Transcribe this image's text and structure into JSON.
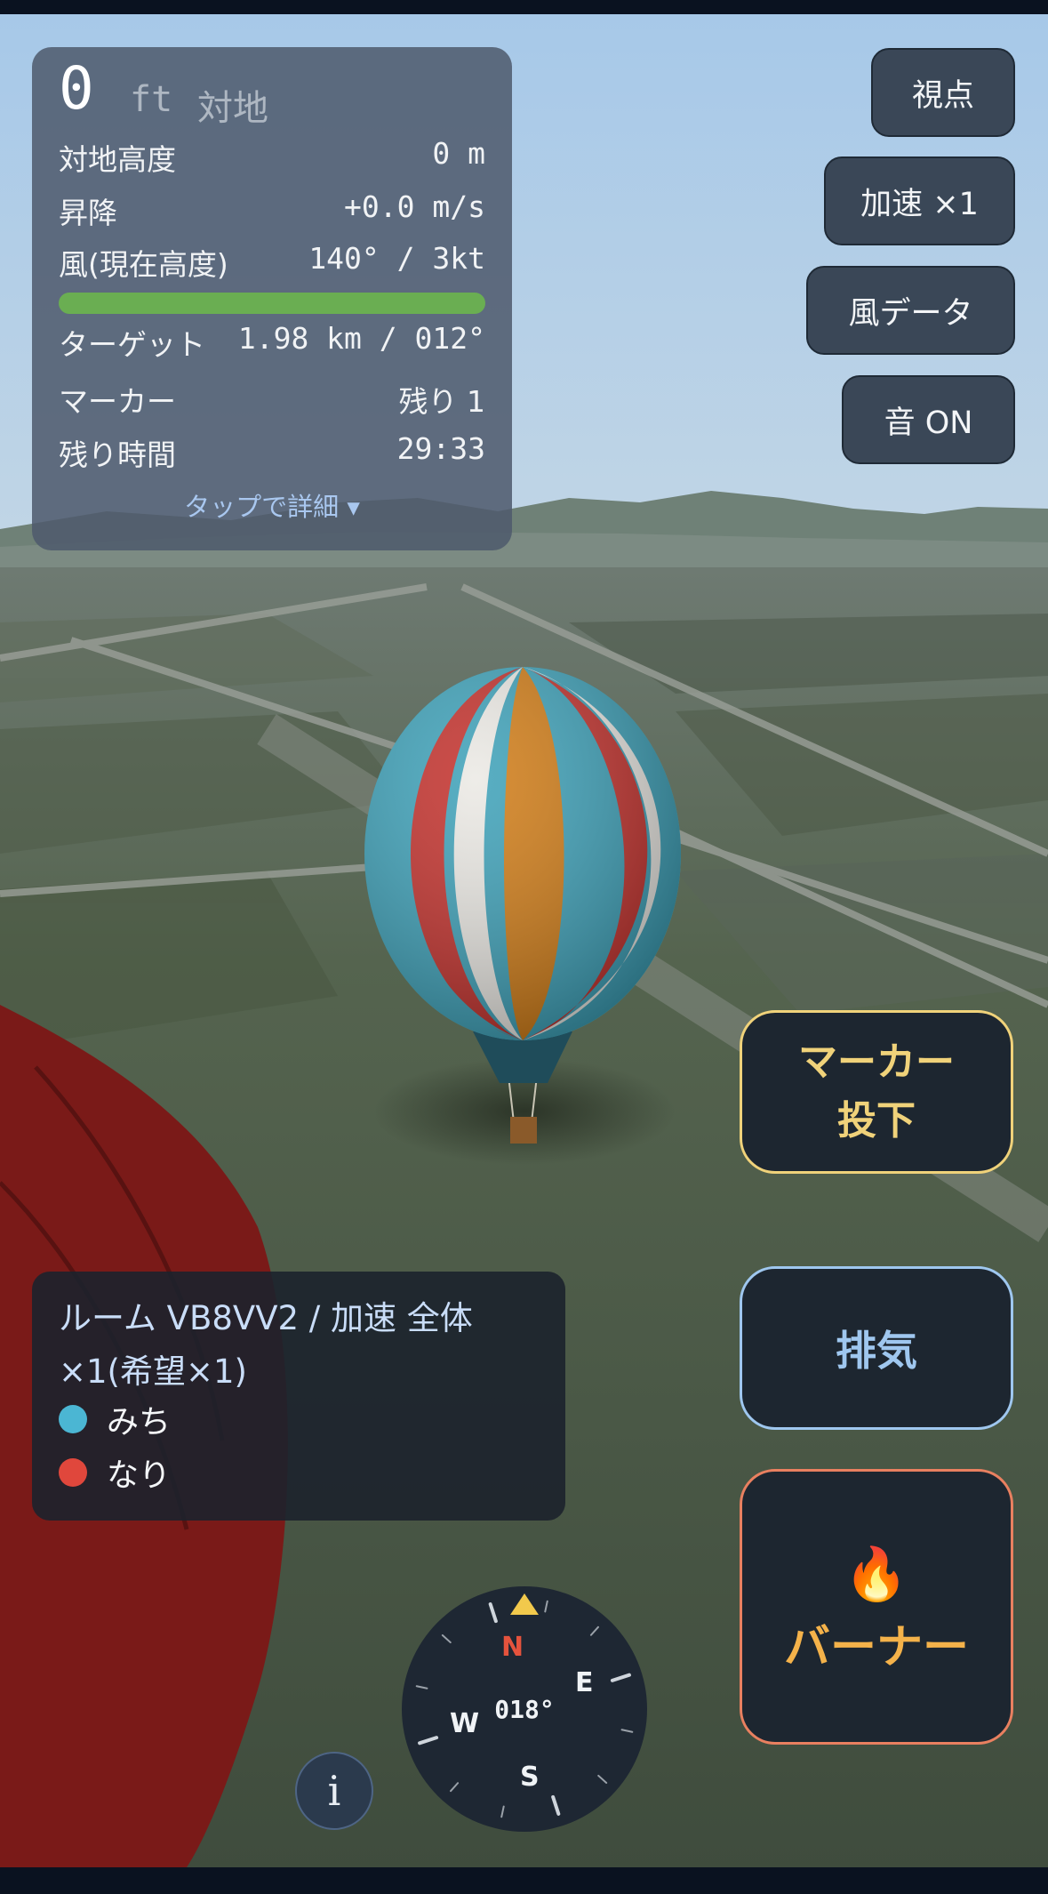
{
  "hud": {
    "altitude_value": "0",
    "altitude_unit": "ft",
    "altitude_ref": "対地",
    "rows": [
      {
        "label": "対地高度",
        "value": "0 m"
      },
      {
        "label": "昇降",
        "value": "+0.0 m/s"
      },
      {
        "label": "風(現在高度)",
        "value": "140° / 3kt"
      },
      {
        "label": "ターゲット",
        "value": "1.98 km / 012°"
      },
      {
        "label": "マーカー",
        "value": "残り 1"
      },
      {
        "label": "残り時間",
        "value": "29:33"
      }
    ],
    "wind_bar_fill": 1.0,
    "wind_bar_color": "#6aae52",
    "detail_link": "タップで詳細 ▾"
  },
  "top_buttons": {
    "view": "視点",
    "speed": "加速 ×1",
    "wind_data": "風データ",
    "sound": "音 ON"
  },
  "action_buttons": {
    "marker_line1": "マーカー",
    "marker_line2": "投下",
    "marker_color": "#f0d27a",
    "vent": "排気",
    "vent_color": "#9fc7ef",
    "burner_icon": "🔥",
    "burner": "バーナー",
    "burner_color": "#f4b24a"
  },
  "room": {
    "line1": "ルーム VB8VV2 / 加速 全体",
    "line2": "×1(希望×1)",
    "players": [
      {
        "name": "みち",
        "color": "#4bb6d3"
      },
      {
        "name": "なり",
        "color": "#e0473c"
      }
    ]
  },
  "compass": {
    "heading": "018°",
    "n": "N",
    "e": "E",
    "s": "S",
    "w": "W"
  },
  "info_icon": "i"
}
